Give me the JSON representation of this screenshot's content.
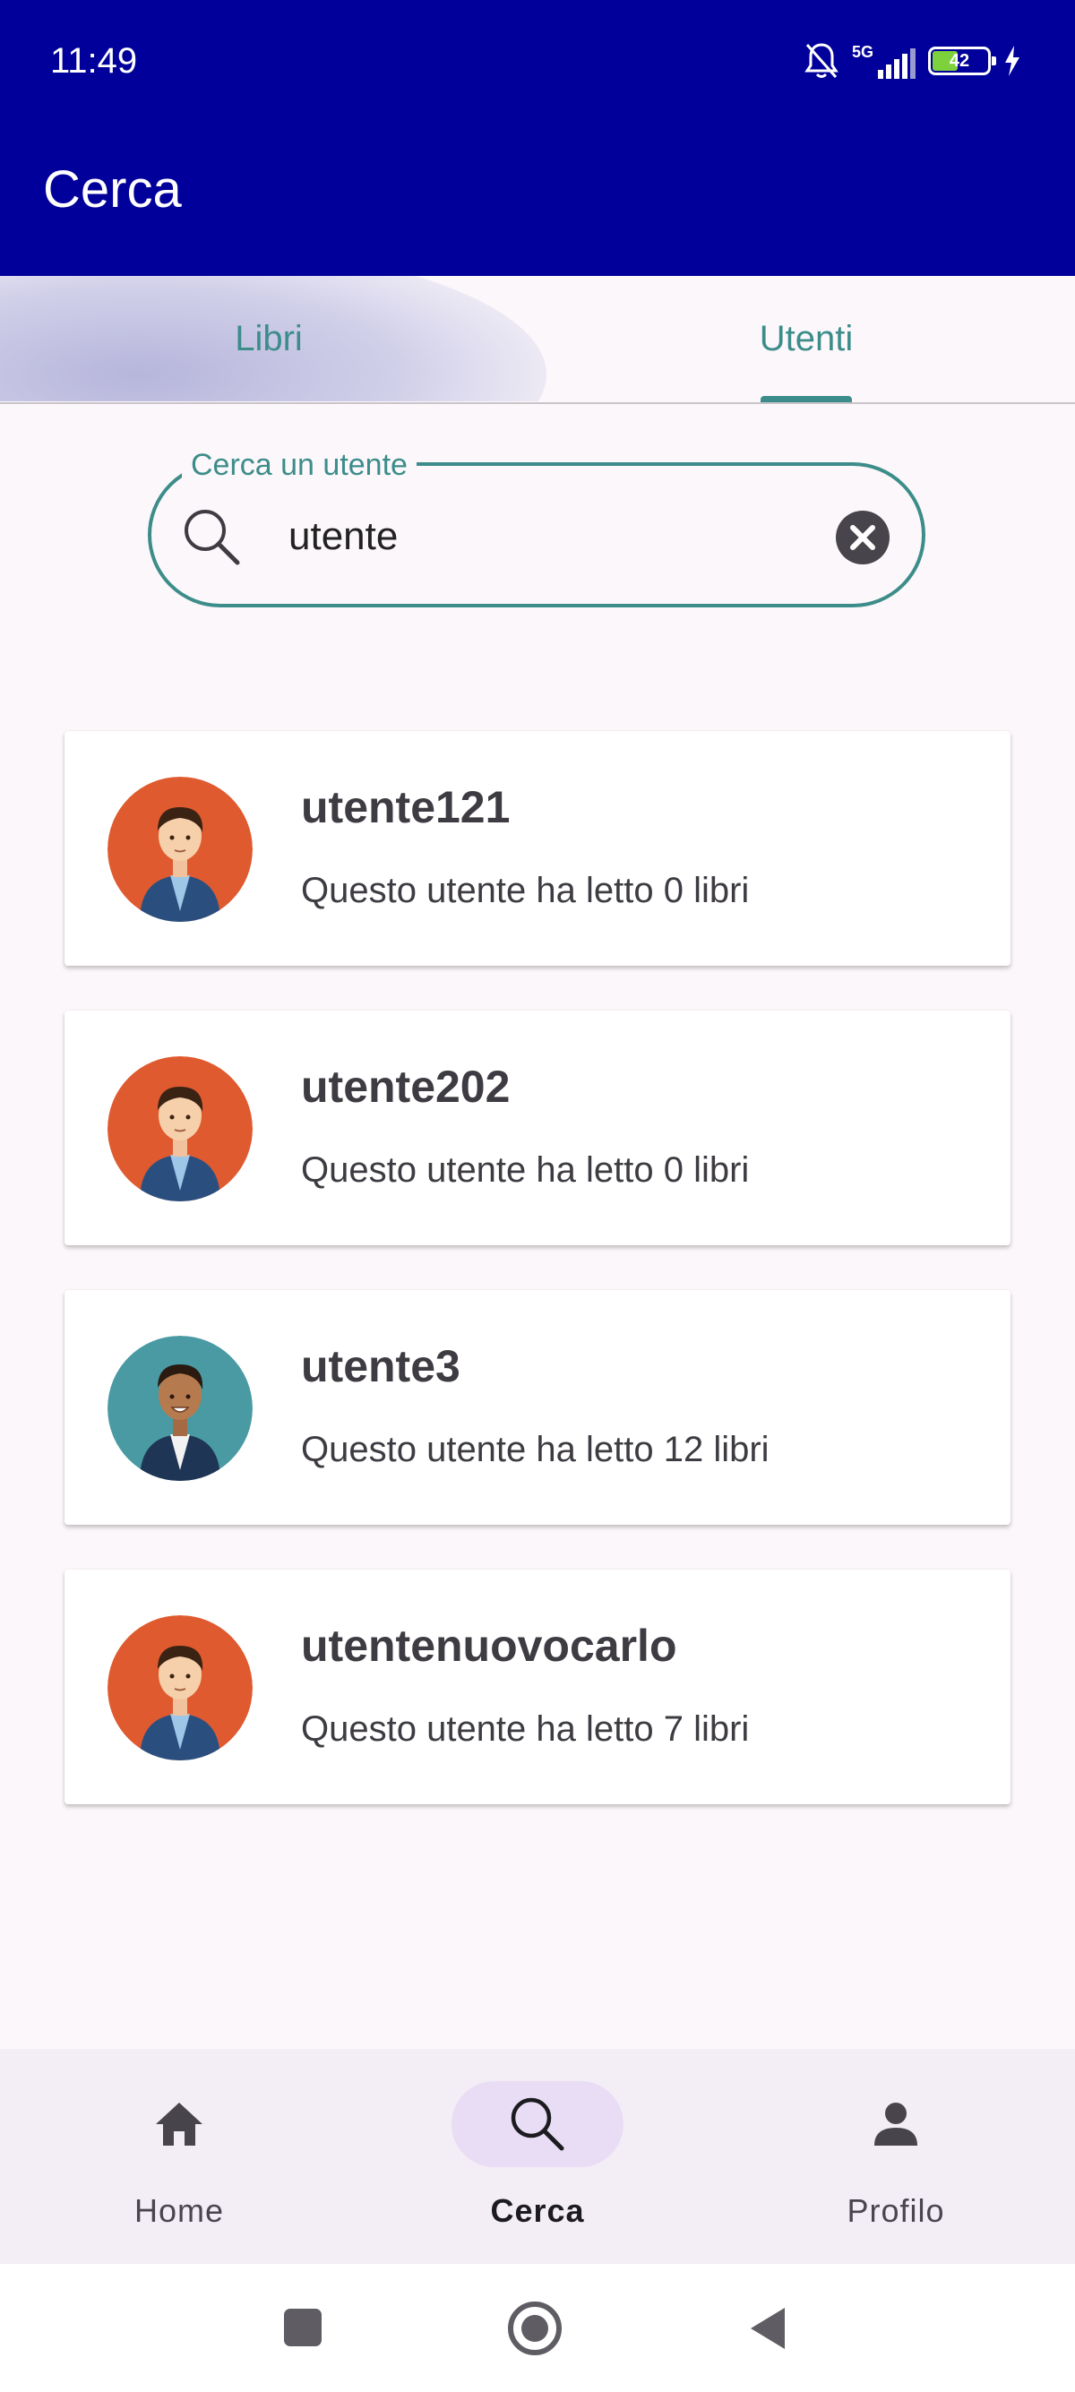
{
  "status_bar": {
    "time": "11:49",
    "network": "5G",
    "battery": "42"
  },
  "app_bar": {
    "title": "Cerca"
  },
  "tabs": [
    {
      "label": "Libri",
      "selected": false
    },
    {
      "label": "Utenti",
      "selected": true
    }
  ],
  "search": {
    "label": "Cerca un utente",
    "value": "utente"
  },
  "results": [
    {
      "name": "utente121",
      "books": "Questo utente ha letto 0 libri",
      "avatar": "avatar-orange"
    },
    {
      "name": "utente202",
      "books": "Questo utente ha letto 0 libri",
      "avatar": "avatar-orange"
    },
    {
      "name": "utente3",
      "books": "Questo utente ha letto 12 libri",
      "avatar": "avatar-teal"
    },
    {
      "name": "utentenuovocarlo",
      "books": "Questo utente ha letto 7 libri",
      "avatar": "avatar-orange"
    }
  ],
  "bottom_nav": [
    {
      "label": "Home",
      "icon": "home-icon",
      "selected": false
    },
    {
      "label": "Cerca",
      "icon": "search-icon",
      "selected": true
    },
    {
      "label": "Profilo",
      "icon": "person-icon",
      "selected": false
    }
  ],
  "colors": {
    "app_bar": "#01009a",
    "accent": "#3c8d8a",
    "avatar_orange": "#df5a2f",
    "avatar_teal": "#4a9aa3"
  }
}
